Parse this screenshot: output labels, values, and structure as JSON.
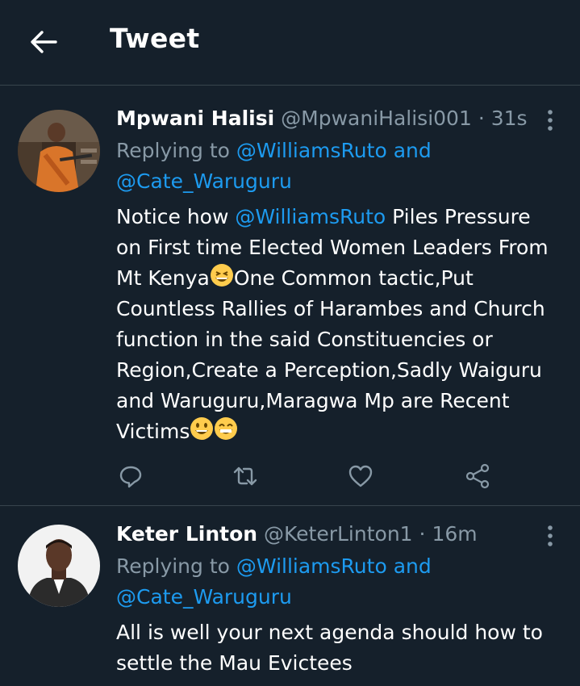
{
  "header": {
    "title": "Tweet"
  },
  "tweets": [
    {
      "name": "Mpwani Halisi",
      "handle": "@MpwaniHalisi001",
      "separator": "·",
      "time": "31s",
      "replying_prefix": "Replying to",
      "replying_user1": "@WilliamsRuto",
      "replying_and": "and",
      "replying_user2": "@Cate_Waruguru",
      "text_start": "Notice how",
      "text_mention": "@WilliamsRuto",
      "text_l1_rest": "Piles Pressure",
      "text_l2": "on First time Elected Women Leaders From",
      "text_l3a": "Mt Kenya",
      "text_l3b": "One Common tactic,Put",
      "text_l4": "Countless Rallies of Harambes and Church",
      "text_l5": "function in the said Constituencies or",
      "text_l6": "Region,Create a Perception,Sadly Waiguru",
      "text_l7": "and Waruguru,Maragwa Mp are Recent",
      "text_l8": "Victims"
    },
    {
      "name": "Keter Linton",
      "handle": "@KeterLinton1",
      "separator": "·",
      "time": "16m",
      "replying_prefix": "Replying to",
      "replying_user1": "@WilliamsRuto",
      "replying_and": "and",
      "replying_user2": "@Cate_Waruguru",
      "text_l1": "All is well your next agenda should how to",
      "text_l2": "settle the Mau Evictees"
    }
  ],
  "icons": {
    "back": "arrow-left-icon",
    "more": "more-vertical-icon",
    "reply": "reply-icon",
    "retweet": "retweet-icon",
    "like": "heart-icon",
    "share": "share-icon"
  },
  "colors": {
    "background": "#15202b",
    "accent": "#1d9bf0",
    "secondary_text": "#8899a6",
    "divider": "#38444d"
  }
}
